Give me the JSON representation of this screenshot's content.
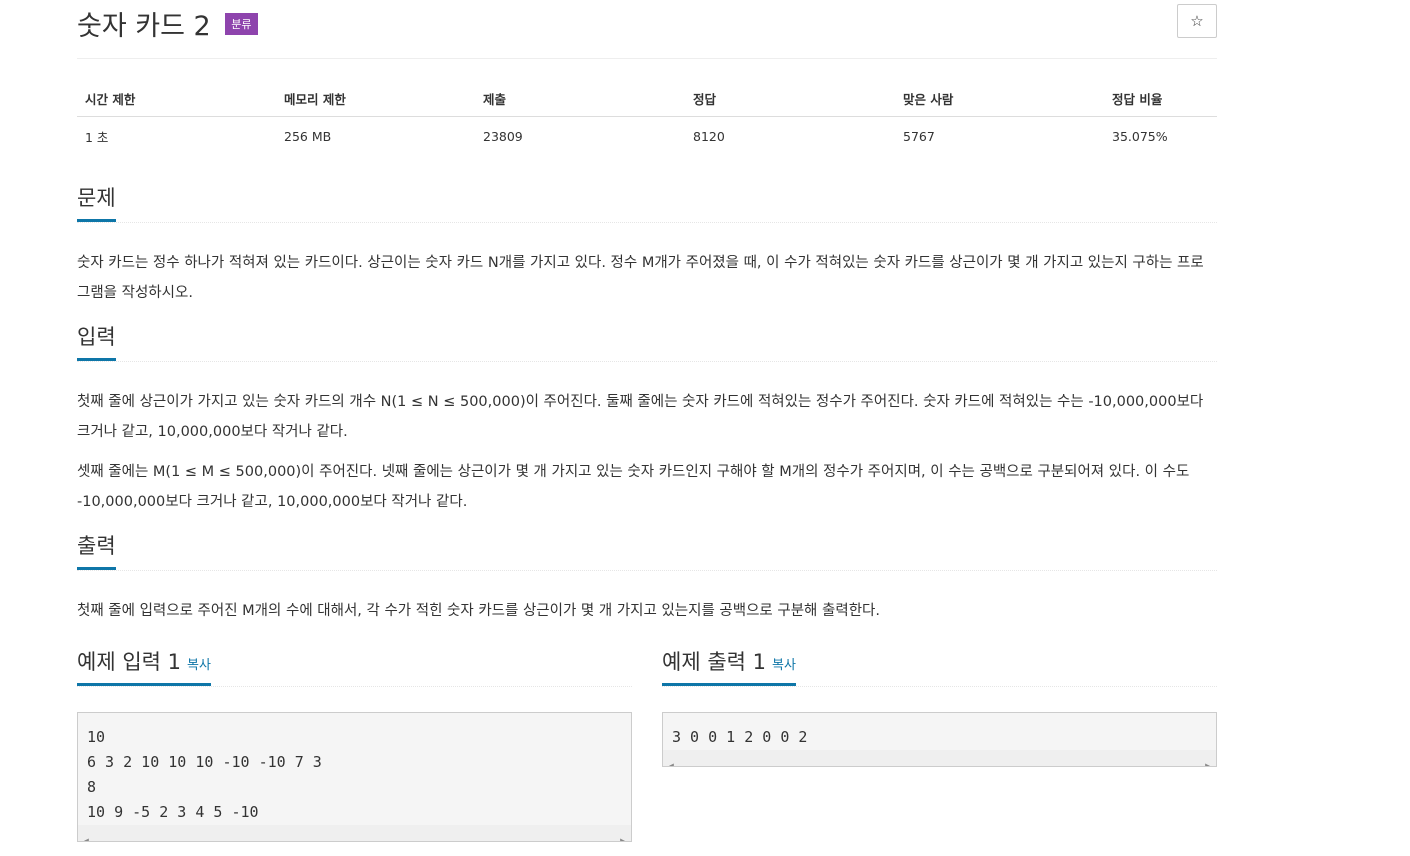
{
  "problem": {
    "title": "숫자 카드 2",
    "badge": "분류",
    "star_icon": "☆"
  },
  "info_table": {
    "headers": [
      "시간 제한",
      "메모리 제한",
      "제출",
      "정답",
      "맞은 사람",
      "정답 비율"
    ],
    "values": [
      "1 초",
      "256 MB",
      "23809",
      "8120",
      "5767",
      "35.075%"
    ]
  },
  "sections": {
    "description": {
      "heading": "문제",
      "paragraphs": [
        "숫자 카드는 정수 하나가 적혀져 있는 카드이다. 상근이는 숫자 카드 N개를 가지고 있다. 정수 M개가 주어졌을 때, 이 수가 적혀있는 숫자 카드를 상근이가 몇 개 가지고 있는지 구하는 프로그램을 작성하시오."
      ]
    },
    "input": {
      "heading": "입력",
      "paragraphs": [
        "첫째 줄에 상근이가 가지고 있는 숫자 카드의 개수 N(1 ≤ N ≤ 500,000)이 주어진다. 둘째 줄에는 숫자 카드에 적혀있는 정수가 주어진다. 숫자 카드에 적혀있는 수는 -10,000,000보다 크거나 같고, 10,000,000보다 작거나 같다.",
        "셋째 줄에는 M(1 ≤ M ≤ 500,000)이 주어진다. 넷째 줄에는 상근이가 몇 개 가지고 있는 숫자 카드인지 구해야 할 M개의 정수가 주어지며, 이 수는 공백으로 구분되어져 있다. 이 수도 -10,000,000보다 크거나 같고, 10,000,000보다 작거나 같다."
      ]
    },
    "output": {
      "heading": "출력",
      "paragraphs": [
        "첫째 줄에 입력으로 주어진 M개의 수에 대해서, 각 수가 적힌 숫자 카드를 상근이가 몇 개 가지고 있는지를 공백으로 구분해 출력한다."
      ]
    }
  },
  "examples": {
    "input": {
      "heading": "예제 입력 1",
      "copy_label": "복사",
      "text": "10\n6 3 2 10 10 10 -10 -10 7 3\n8\n10 9 -5 2 3 4 5 -10"
    },
    "output": {
      "heading": "예제 출력 1",
      "copy_label": "복사",
      "text": "3 0 0 1 2 0 0 2"
    }
  }
}
